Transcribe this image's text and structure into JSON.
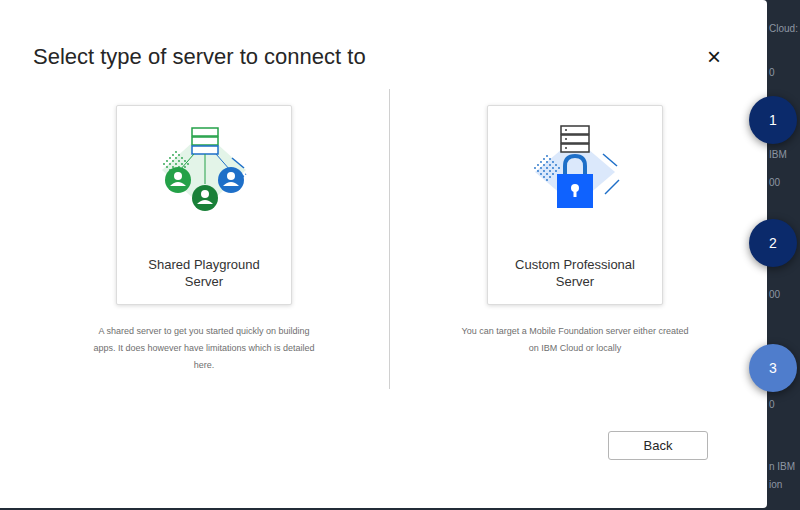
{
  "dialog": {
    "title": "Select type of server to connect to",
    "close": "×"
  },
  "options": [
    {
      "kind": "shared",
      "label": "Shared Playground Server",
      "description": "A shared server to get you started quickly on building apps. It does however have limitations which is detailed here."
    },
    {
      "kind": "custom",
      "label": "Custom Professional Server",
      "description": "You can target a Mobile Foundation server either created on IBM Cloud or locally"
    }
  ],
  "buttons": [
    "Back"
  ],
  "steps": [
    {
      "label": "1",
      "color": "#0b2a6b"
    },
    {
      "label": "2",
      "color": "#0b2a6b"
    },
    {
      "label": "3",
      "color": "#4f7dcc"
    }
  ],
  "background_texts": [
    "Cloud:",
    "0",
    "IBM",
    "00",
    "00",
    "0",
    "n IBM",
    "ion"
  ]
}
